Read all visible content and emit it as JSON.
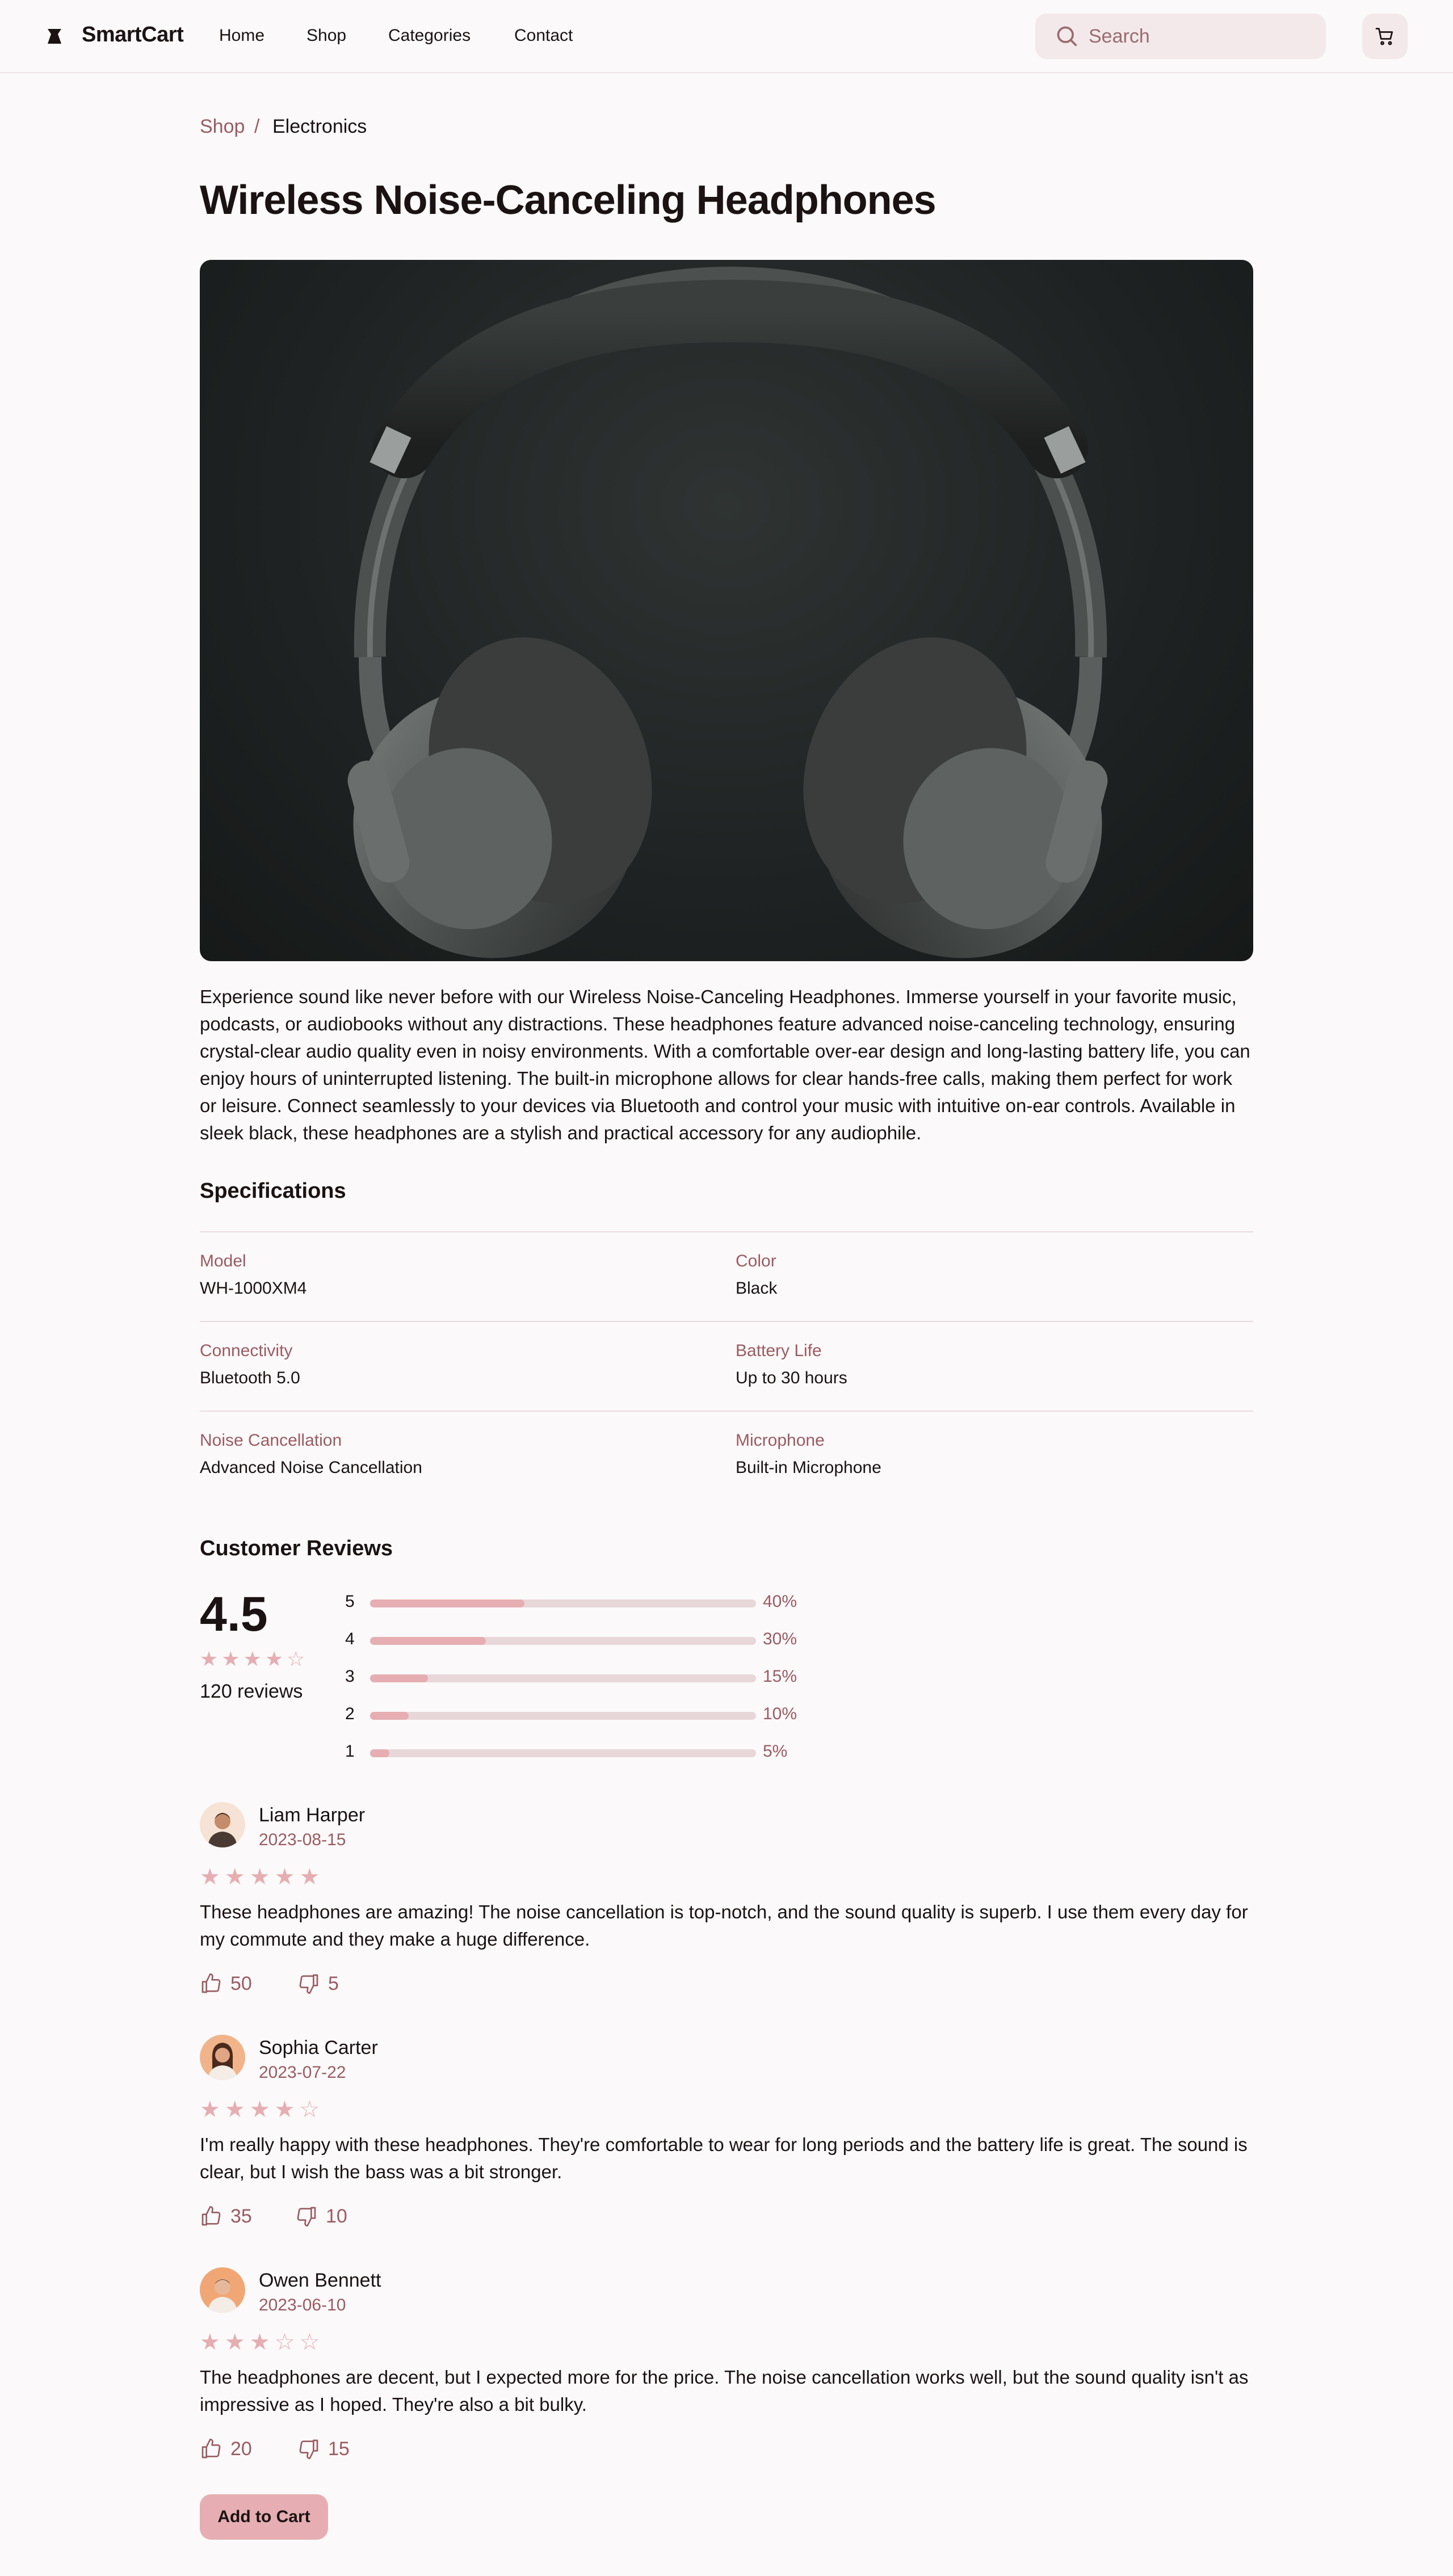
{
  "header": {
    "brand": "SmartCart",
    "nav": [
      "Home",
      "Shop",
      "Categories",
      "Contact"
    ],
    "search_placeholder": "Search"
  },
  "breadcrumb": {
    "shop": "Shop",
    "separator": "/",
    "current": "Electronics"
  },
  "product": {
    "title": "Wireless Noise-Canceling Headphones",
    "description": "Experience sound like never before with our Wireless Noise-Canceling Headphones. Immerse yourself in your favorite music, podcasts, or audiobooks without any distractions. These headphones feature advanced noise-canceling technology, ensuring crystal-clear audio quality even in noisy environments. With a comfortable over-ear design and long-lasting battery life, you can enjoy hours of uninterrupted listening. The built-in microphone allows for clear hands-free calls, making them perfect for work or leisure. Connect seamlessly to your devices via Bluetooth and control your music with intuitive on-ear controls. Available in sleek black, these headphones are a stylish and practical accessory for any audiophile."
  },
  "specs": {
    "title": "Specifications",
    "items": [
      {
        "label": "Model",
        "value": "WH-1000XM4"
      },
      {
        "label": "Color",
        "value": "Black"
      },
      {
        "label": "Connectivity",
        "value": "Bluetooth 5.0"
      },
      {
        "label": "Battery Life",
        "value": "Up to 30 hours"
      },
      {
        "label": "Noise Cancellation",
        "value": "Advanced Noise Cancellation"
      },
      {
        "label": "Microphone",
        "value": "Built-in Microphone"
      }
    ]
  },
  "reviews_summary": {
    "title": "Customer Reviews",
    "average": "4.5",
    "average_stars": 4,
    "count_text": "120 reviews",
    "distribution": [
      {
        "label": "5",
        "percent": 40,
        "percent_text": "40%"
      },
      {
        "label": "4",
        "percent": 30,
        "percent_text": "30%"
      },
      {
        "label": "3",
        "percent": 15,
        "percent_text": "15%"
      },
      {
        "label": "2",
        "percent": 10,
        "percent_text": "10%"
      },
      {
        "label": "1",
        "percent": 5,
        "percent_text": "5%"
      }
    ]
  },
  "reviews": [
    {
      "name": "Liam Harper",
      "date": "2023-08-15",
      "stars": 5,
      "text": "These headphones are amazing! The noise cancellation is top-notch, and the sound quality is superb. I use them every day for my commute and they make a huge difference.",
      "likes": "50",
      "dislikes": "5"
    },
    {
      "name": "Sophia Carter",
      "date": "2023-07-22",
      "stars": 4,
      "text": "I'm really happy with these headphones. They're comfortable to wear for long periods and the battery life is great. The sound is clear, but I wish the bass was a bit stronger.",
      "likes": "35",
      "dislikes": "10"
    },
    {
      "name": "Owen Bennett",
      "date": "2023-06-10",
      "stars": 3,
      "text": "The headphones are decent, but I expected more for the price. The noise cancellation works well, but the sound quality isn't as impressive as I hoped. They're also a bit bulky.",
      "likes": "20",
      "dislikes": "15"
    }
  ],
  "actions": {
    "add_to_cart": "Add to Cart"
  },
  "colors": {
    "accent": "#e6aeb2",
    "muted_text": "#9a5b62",
    "background": "#fbf9fa"
  }
}
